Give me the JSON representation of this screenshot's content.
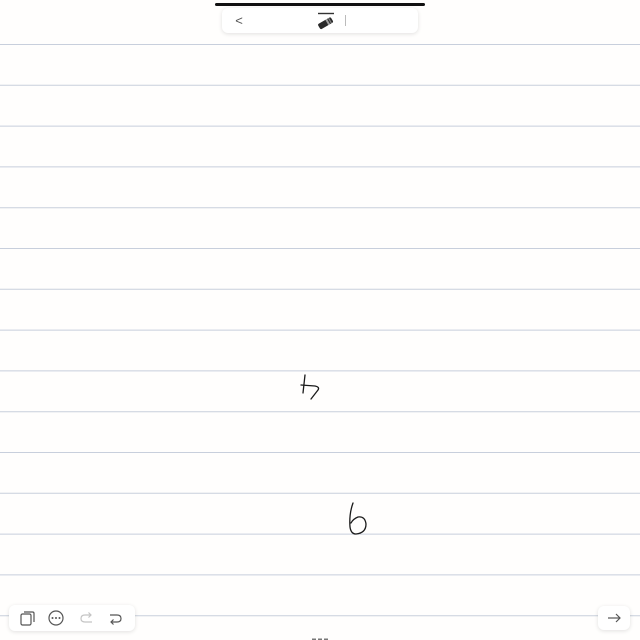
{
  "top_toolbar": {
    "back_label": "<"
  },
  "icons": {
    "pen": "pen-icon",
    "pages": "pages-icon",
    "more": "more-icon",
    "undo": "undo-icon",
    "redo": "redo-icon",
    "next": "arrow-right-icon",
    "handle": "drag-handle-icon"
  },
  "colors": {
    "rule_line": "#c8cfdc",
    "ink": "#1a1a1a",
    "undo_disabled": "#c4c4c4",
    "icon": "#555555"
  },
  "handwriting": [
    "4",
    "6"
  ]
}
